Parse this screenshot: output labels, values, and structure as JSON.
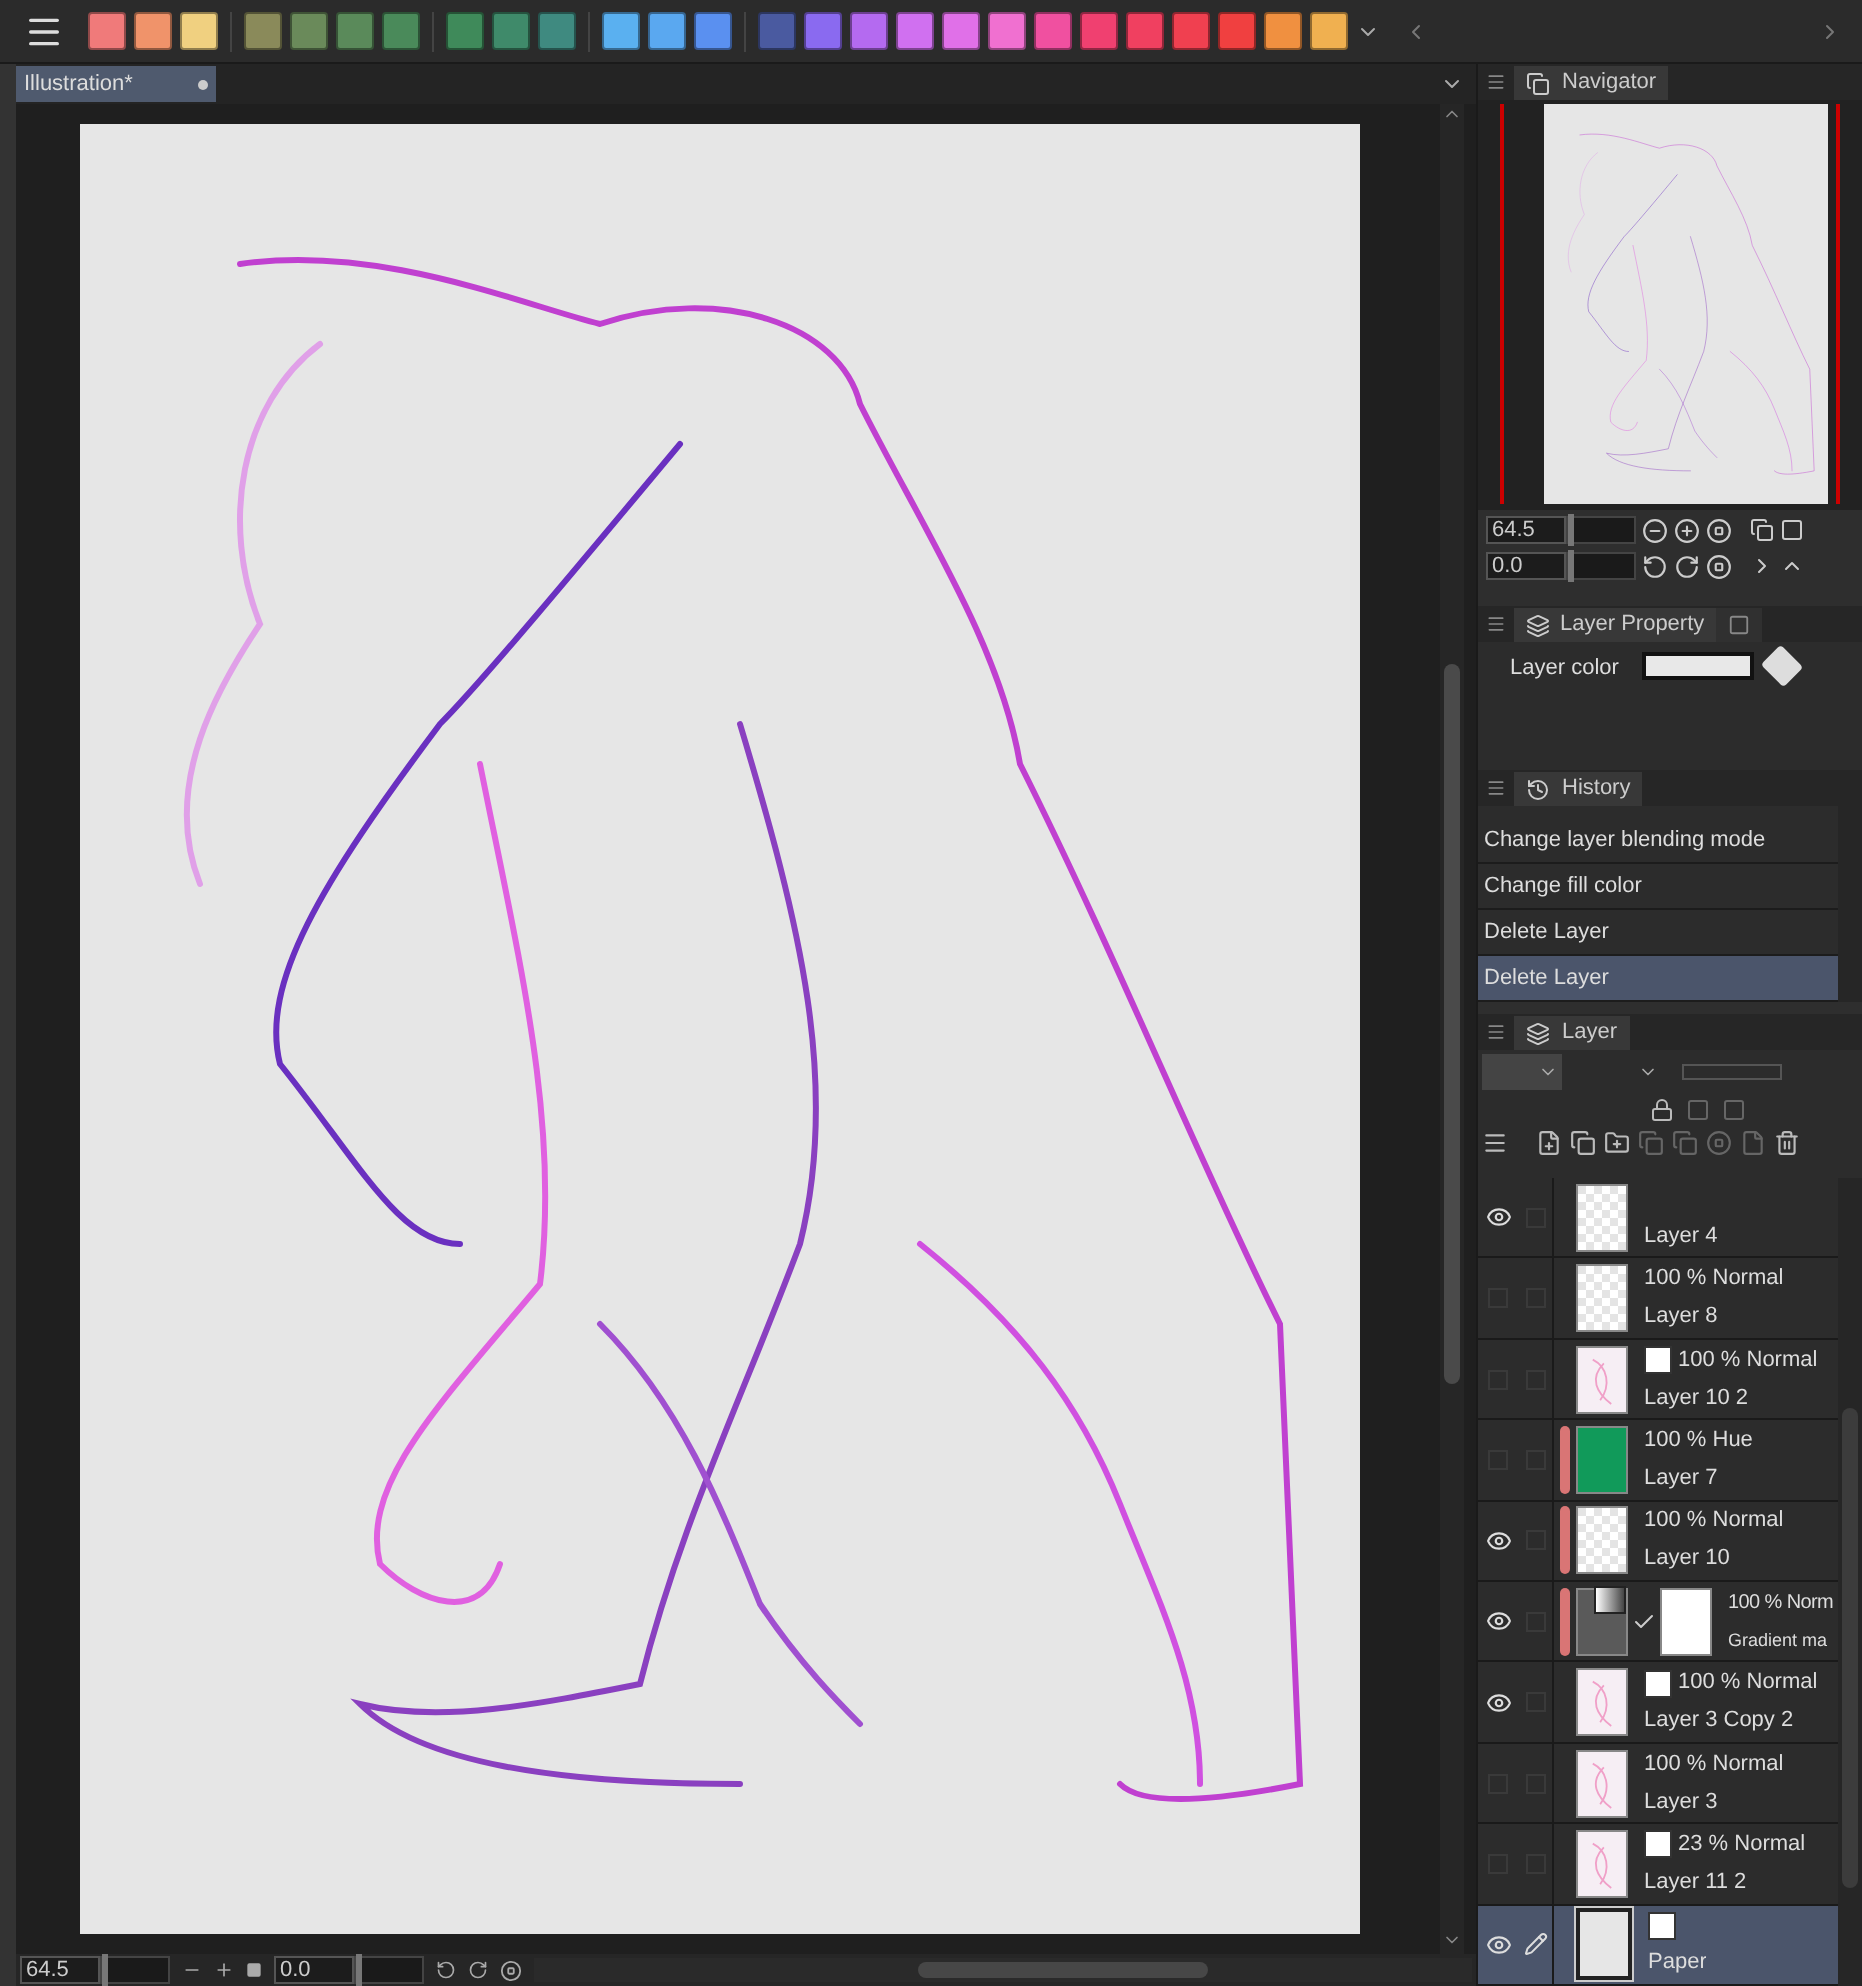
{
  "document_tab": {
    "title": "Illustration*"
  },
  "bottom_bar": {
    "zoom": "64.5",
    "rotation": "0.0"
  },
  "navigator": {
    "title": "Navigator",
    "zoom": "64.5",
    "rotation": "0.0"
  },
  "layer_property": {
    "title": "Layer Property",
    "layer_color_label": "Layer color"
  },
  "history": {
    "title": "History",
    "items": [
      {
        "label": "Change layer blending mode",
        "selected": false
      },
      {
        "label": "Change fill color",
        "selected": false
      },
      {
        "label": "Delete Layer",
        "selected": false
      },
      {
        "label": "Delete Layer",
        "selected": true
      }
    ]
  },
  "layer_panel": {
    "title": "Layer",
    "layers": [
      {
        "name": "Layer 4",
        "visible": true,
        "selected": false,
        "color_bar": false,
        "kind": "checker",
        "raster_icon": false
      },
      {
        "name": "Layer 8",
        "mode": "100 % Normal",
        "visible": false,
        "selected": false,
        "color_bar": false,
        "kind": "checker",
        "raster_icon": false
      },
      {
        "name": "Layer 10 2",
        "mode": "100 % Normal",
        "visible": false,
        "selected": false,
        "color_bar": false,
        "kind": "sketch",
        "raster_icon": true
      },
      {
        "name": "Layer 7",
        "mode": "100 % Hue",
        "visible": false,
        "selected": false,
        "color_bar": true,
        "kind": "fill",
        "color": "#119a5a",
        "raster_icon": false
      },
      {
        "name": "Layer 10",
        "mode": "100 % Normal",
        "visible": true,
        "selected": false,
        "color_bar": true,
        "kind": "checker",
        "raster_icon": false
      },
      {
        "name": "Gradient ma",
        "mode": "100 % Norm",
        "visible": true,
        "selected": false,
        "color_bar": true,
        "kind": "gradient",
        "raster_icon": false
      },
      {
        "name": "Layer 3 Copy 2",
        "mode": "100 % Normal",
        "visible": true,
        "selected": false,
        "color_bar": false,
        "kind": "sketch",
        "raster_icon": true
      },
      {
        "name": "Layer 3",
        "mode": "100 % Normal",
        "visible": false,
        "selected": false,
        "color_bar": false,
        "kind": "sketch",
        "raster_icon": false
      },
      {
        "name": "Layer 11 2",
        "mode": "23 % Normal",
        "visible": false,
        "selected": false,
        "color_bar": false,
        "kind": "sketch",
        "raster_icon": true
      },
      {
        "name": "Paper",
        "visible": true,
        "selected": true,
        "color_bar": false,
        "kind": "paper",
        "raster_icon": false,
        "editing": true
      }
    ]
  }
}
